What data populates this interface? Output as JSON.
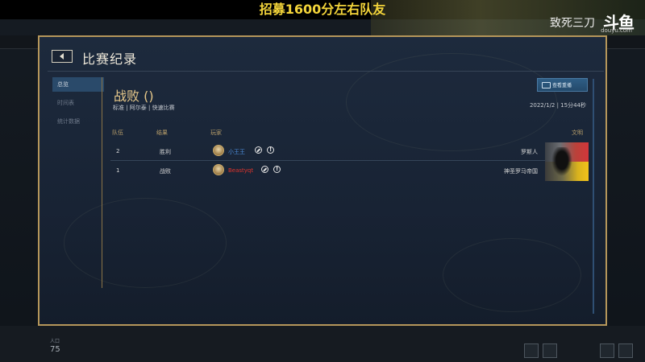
{
  "stream": {
    "banner": "招募1600分左右队友",
    "streamer": "致死三刀",
    "platform_logo": "斗鱼",
    "platform_sub": "douyu.com"
  },
  "dialog": {
    "title": "比赛纪录",
    "back_icon": "back-arrow-icon"
  },
  "sidebar": {
    "items": [
      {
        "label": "总览",
        "active": true
      },
      {
        "label": "时间表",
        "active": false
      },
      {
        "label": "统计数据",
        "active": false
      }
    ]
  },
  "match": {
    "result_title": "战败 ()",
    "subline": "标准 | 阿尔泰 | 快速比赛",
    "datetime": "2022/1/2 | 15分44秒",
    "replay_label": "查看重播"
  },
  "table": {
    "headers": {
      "team": "队伍",
      "result": "结果",
      "player": "玩家",
      "civ": "文明"
    },
    "rows": [
      {
        "team": "2",
        "result": "胜利",
        "player": "小王王",
        "player_color": "#4a8ad8",
        "civ": "罗斯人"
      },
      {
        "team": "1",
        "result": "战败",
        "player": "Beastyqt",
        "player_color": "#e0342c",
        "civ": "神圣罗马帝国"
      }
    ]
  },
  "hud": {
    "pop_label": "人口",
    "pop_value": "75"
  }
}
